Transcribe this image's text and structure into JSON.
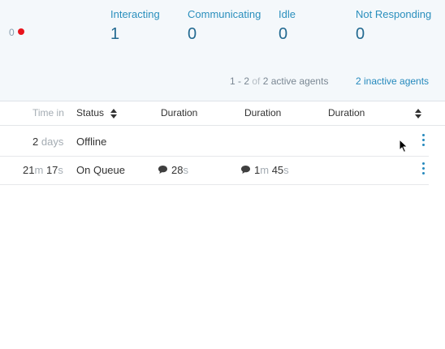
{
  "summary": {
    "offline_count": "0",
    "stats": [
      {
        "label": "Interacting",
        "value": "1"
      },
      {
        "label": "Communicating",
        "value": "0"
      },
      {
        "label": "Idle",
        "value": "0"
      },
      {
        "label": "Not Responding",
        "value": "0"
      }
    ],
    "paging": {
      "range": "1 - 2",
      "of": "of",
      "total": "2 active agents"
    },
    "inactive_link": "2 inactive agents"
  },
  "table": {
    "headers": {
      "time_in": "Time in",
      "status": "Status",
      "duration1": "Duration",
      "duration2": "Duration",
      "duration3": "Duration"
    },
    "rows": [
      {
        "time_in_value": "2",
        "time_in_unit": "days",
        "status": "Offline"
      },
      {
        "time_in_a": "21",
        "time_in_a_unit": "m",
        "time_in_b": "17",
        "time_in_b_unit": "s",
        "status": "On Queue",
        "dur1_value": "28",
        "dur1_unit": "s",
        "dur2_a": "1",
        "dur2_a_unit": "m",
        "dur2_b": "45",
        "dur2_b_unit": "s"
      }
    ]
  },
  "colors": {
    "accent": "#2589bd",
    "value": "#236a91",
    "alert": "#e8141c"
  }
}
